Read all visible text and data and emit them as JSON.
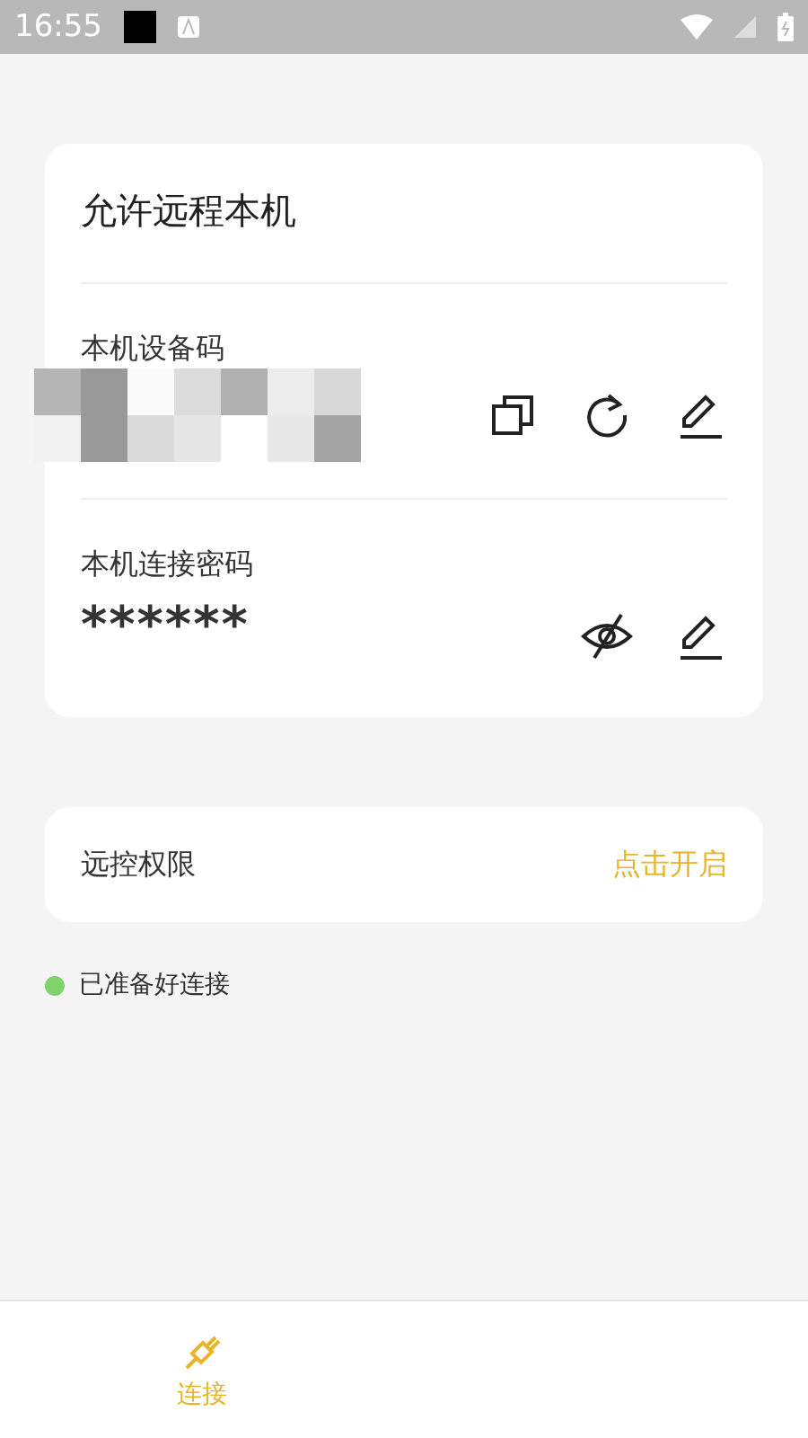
{
  "status_bar": {
    "time": "16:55"
  },
  "remote_card": {
    "title": "允许远程本机",
    "device_code": {
      "label": "本机设备码"
    },
    "password": {
      "label": "本机连接密码",
      "value": "******",
      "visible": false
    }
  },
  "permission": {
    "label": "远控权限",
    "action": "点击开启"
  },
  "status": {
    "text": "已准备好连接",
    "color": "#7ed36b"
  },
  "bottom_nav": [
    {
      "label": "连接",
      "selected": true
    }
  ]
}
